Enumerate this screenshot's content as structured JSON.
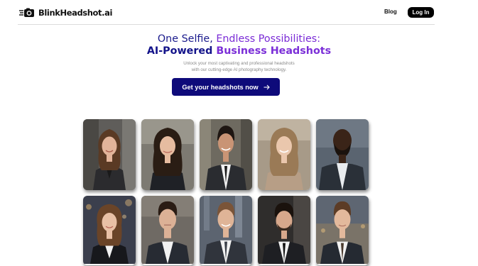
{
  "header": {
    "brand_name": "BlinkHeadshot.ai",
    "blog_label": "Blog",
    "login_label": "Log In"
  },
  "hero": {
    "title_line1_a": "One Selfie,",
    "title_line1_b": "Endless Possibilities:",
    "title_line2_a": "AI-Powered",
    "title_line2_b": "Business Headshots",
    "subtitle_line1": "Unlock your most captivating and professional headshots",
    "subtitle_line2": "with our cutting-edge AI photography technology.",
    "cta_label": "Get your headshots now"
  },
  "colors": {
    "navy": "#13138a",
    "purple": "#7b2fd8",
    "cta_background": "#0e0a7a",
    "login_background": "#000000"
  },
  "gallery": [
    {
      "name": "headshot-woman-brown-hair-office"
    },
    {
      "name": "headshot-woman-long-dark-hair"
    },
    {
      "name": "headshot-man-smiling-city"
    },
    {
      "name": "headshot-woman-blonde-smiling"
    },
    {
      "name": "headshot-man-bald-beard"
    },
    {
      "name": "headshot-woman-brown-hair-night"
    },
    {
      "name": "headshot-man-dark-hair-serious"
    },
    {
      "name": "headshot-man-short-hair-smiling"
    },
    {
      "name": "headshot-man-dark-hair-beard"
    },
    {
      "name": "headshot-man-young-suit"
    }
  ]
}
